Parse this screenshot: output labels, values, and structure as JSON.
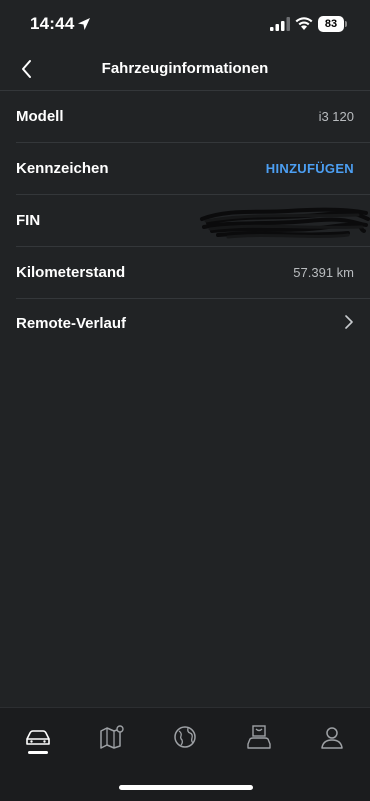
{
  "status_bar": {
    "time": "14:44",
    "battery": "83",
    "icons": [
      "location-arrow-icon",
      "cellular-signal-icon",
      "wifi-icon",
      "battery-icon"
    ]
  },
  "header": {
    "title": "Fahrzeuginformationen",
    "back_icon": "chevron-left-icon"
  },
  "info": {
    "model": {
      "label": "Modell",
      "value": "i3 120"
    },
    "plate": {
      "label": "Kennzeichen",
      "action": "HINZUFÜGEN"
    },
    "vin": {
      "label": "FIN"
    },
    "mileage": {
      "label": "Kilometerstand",
      "value": "57.391 km"
    },
    "remote": {
      "label": "Remote-Verlauf",
      "icon": "chevron-right-icon"
    }
  },
  "bottom_nav": {
    "items": [
      "car-icon",
      "map-icon",
      "globe-icon",
      "shop-car-icon",
      "profile-icon"
    ],
    "active": "car-icon"
  },
  "colors": {
    "background": "#212325",
    "accent": "#4c9ff3",
    "divider": "#34373a"
  }
}
